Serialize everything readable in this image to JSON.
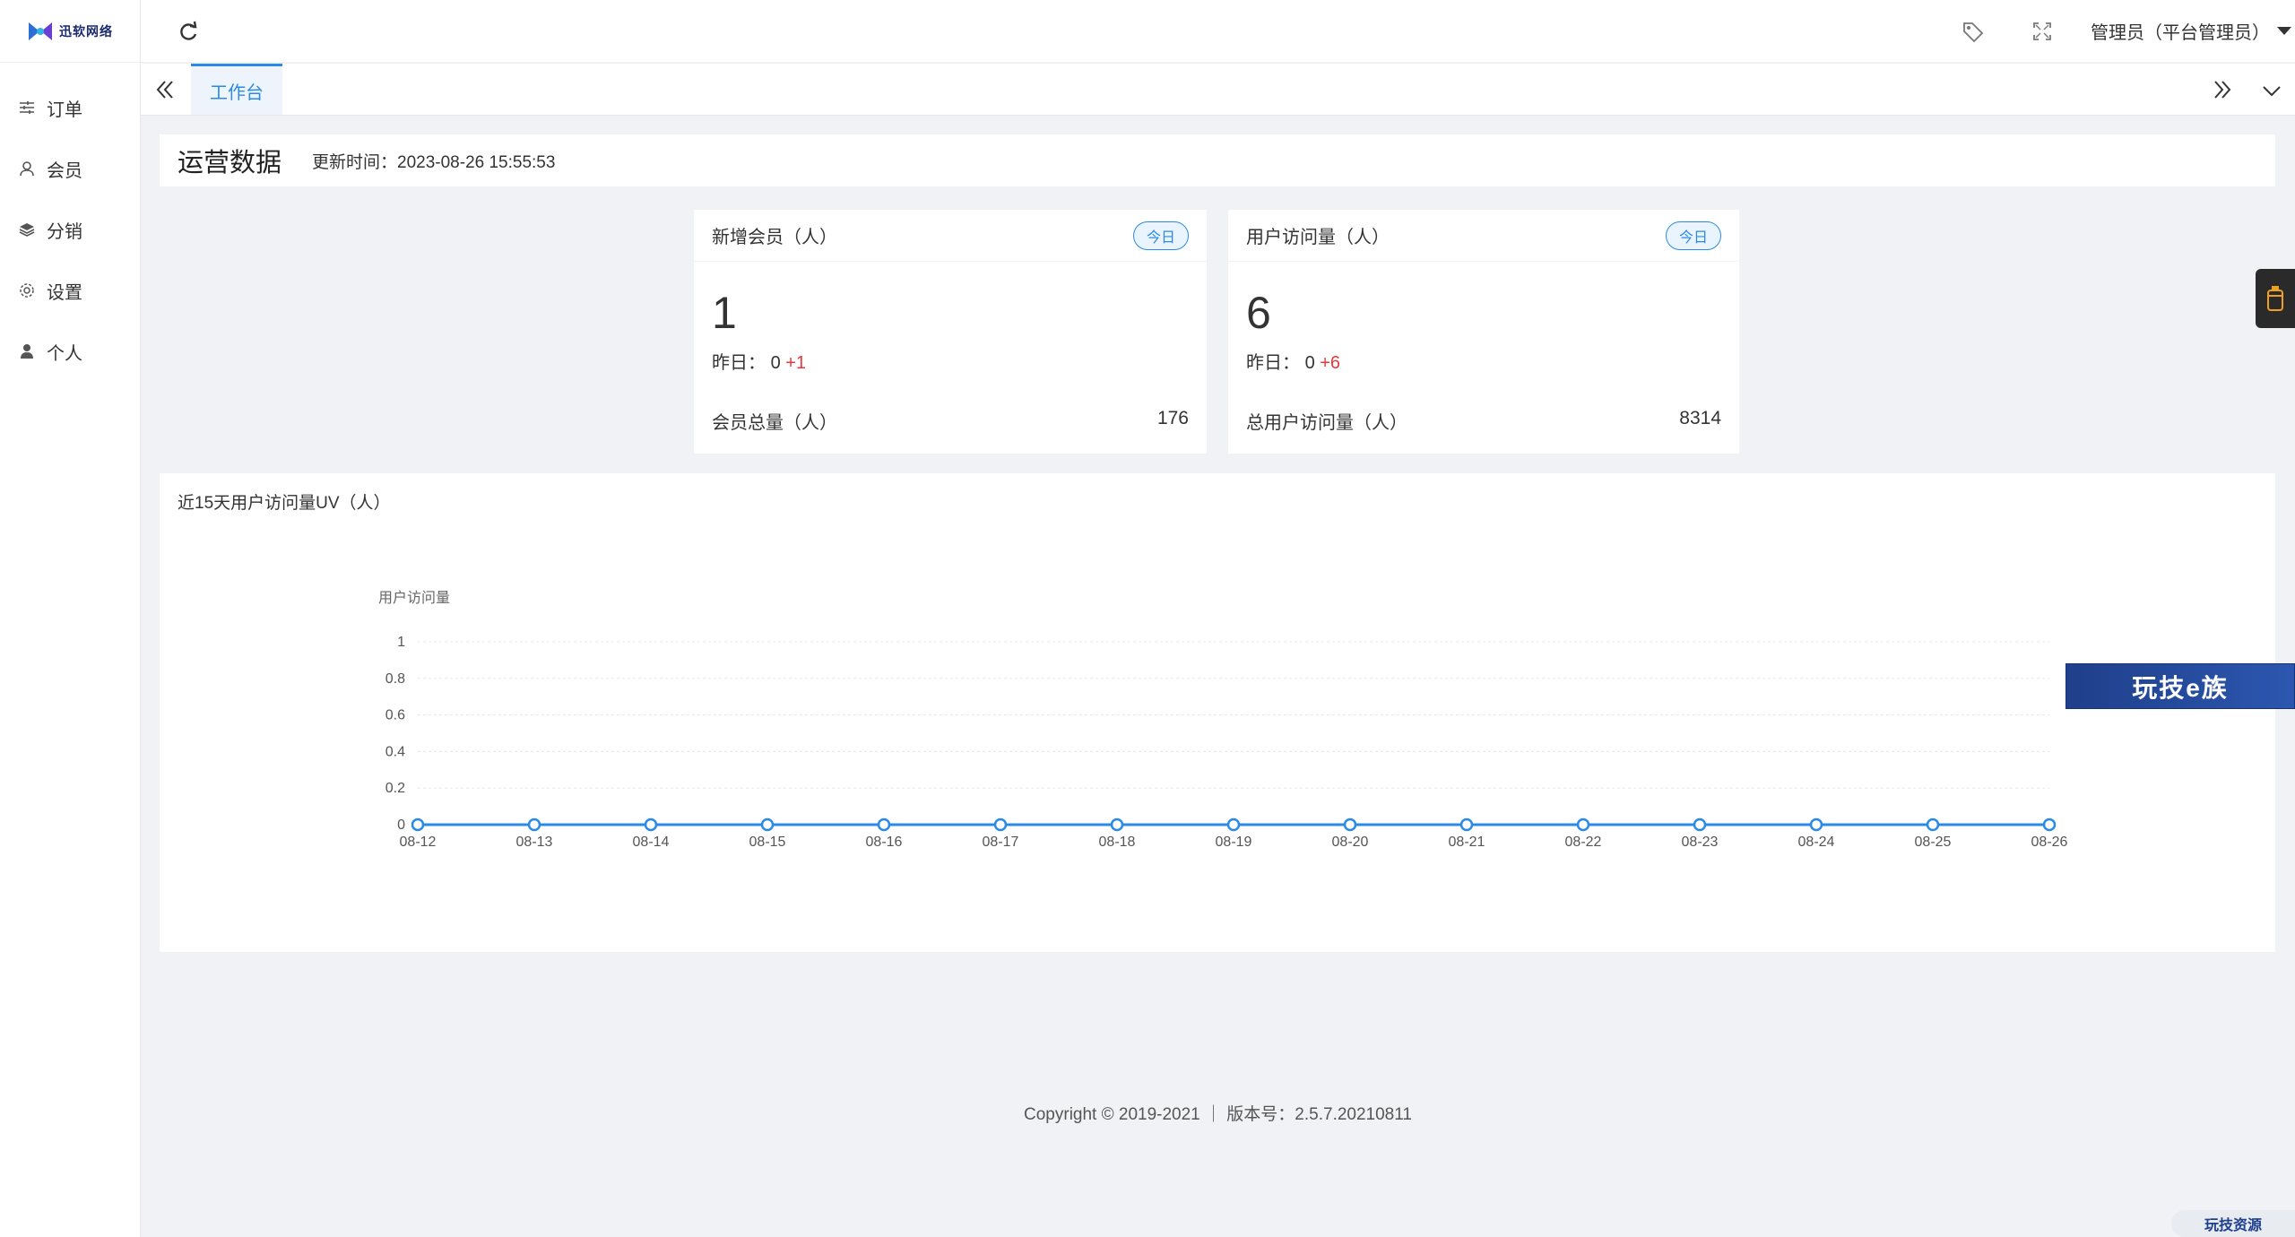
{
  "brand": {
    "logo_text": "迅软网络"
  },
  "sidebar": {
    "items": [
      {
        "label": "订单",
        "icon": "list-icon"
      },
      {
        "label": "会员",
        "icon": "user-outline-icon"
      },
      {
        "label": "分销",
        "icon": "layers-icon"
      },
      {
        "label": "设置",
        "icon": "gear-icon"
      },
      {
        "label": "个人",
        "icon": "person-icon"
      }
    ]
  },
  "topbar": {
    "user_label": "管理员（平台管理员）"
  },
  "tabs": [
    {
      "label": "工作台",
      "active": true
    }
  ],
  "header": {
    "title": "运营数据",
    "update_time": "更新时间：2023-08-26 15:55:53"
  },
  "cards": [
    {
      "title": "新增会员（人）",
      "badge": "今日",
      "value": "1",
      "yesterday_label": "昨日：",
      "yesterday_value": "0",
      "delta": "+1",
      "total_label": "会员总量（人）",
      "total_value": "176"
    },
    {
      "title": "用户访问量（人）",
      "badge": "今日",
      "value": "6",
      "yesterday_label": "昨日：",
      "yesterday_value": "0",
      "delta": "+6",
      "total_label": "总用户访问量（人）",
      "total_value": "8314"
    }
  ],
  "chart_section_title": "近15天用户访问量UV（人）",
  "chart_data": {
    "type": "line",
    "ylabel": "用户访问量",
    "categories": [
      "08-12",
      "08-13",
      "08-14",
      "08-15",
      "08-16",
      "08-17",
      "08-18",
      "08-19",
      "08-20",
      "08-21",
      "08-22",
      "08-23",
      "08-24",
      "08-25",
      "08-26"
    ],
    "series": [
      {
        "values": [
          0,
          0,
          0,
          0,
          0,
          0,
          0,
          0,
          0,
          0,
          0,
          0,
          0,
          0,
          0
        ]
      }
    ],
    "ylim": [
      0,
      1
    ],
    "yticks": [
      "0",
      "0.2",
      "0.4",
      "0.6",
      "0.8",
      "1"
    ],
    "grid": true,
    "color": "#2b8ae6"
  },
  "footer": {
    "text": "Copyright © 2019-2021 ｜ 版本号：2.5.7.20210811"
  },
  "overlays": {
    "banner": "玩技e族",
    "watermark": "玩技资源"
  }
}
